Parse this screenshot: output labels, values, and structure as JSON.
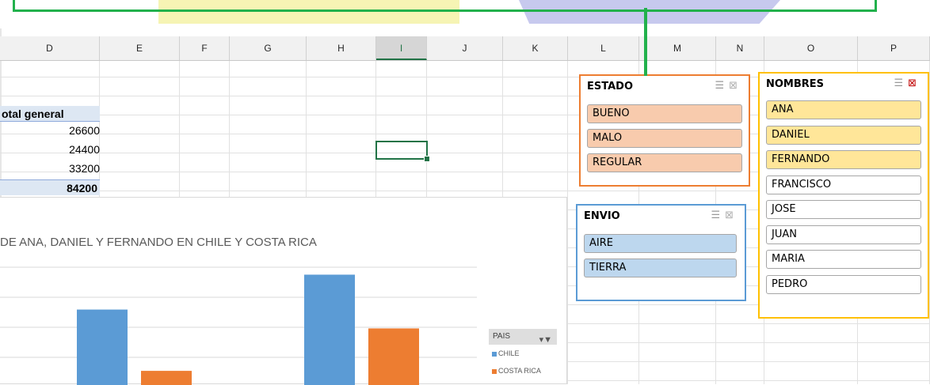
{
  "columns": [
    {
      "label": "D",
      "w": 126
    },
    {
      "label": "E",
      "w": 101
    },
    {
      "label": "F",
      "w": 63
    },
    {
      "label": "G",
      "w": 97
    },
    {
      "label": "H",
      "w": 88
    },
    {
      "label": "I",
      "w": 64,
      "selected": true
    },
    {
      "label": "J",
      "w": 96
    },
    {
      "label": "K",
      "w": 82
    },
    {
      "label": "L",
      "w": 90
    },
    {
      "label": "M",
      "w": 97
    },
    {
      "label": "N",
      "w": 61
    },
    {
      "label": "O",
      "w": 118
    },
    {
      "label": "P",
      "w": 91
    }
  ],
  "pivot": {
    "header": "otal general",
    "values": [
      "26600",
      "24400",
      "33200"
    ],
    "total": "84200"
  },
  "chart_data": {
    "type": "bar",
    "title": "DE ANA, DANIEL Y FERNANDO EN CHILE Y COSTA RICA",
    "legend_title": "PAIS",
    "series": [
      {
        "name": "CHILE",
        "color": "#5b9bd5",
        "values": [
          8000,
          11700
        ]
      },
      {
        "name": "COSTA RICA",
        "color": "#ed7d31",
        "values": [
          1500,
          6000
        ]
      }
    ],
    "ylim": [
      0,
      14000
    ]
  },
  "slicers": {
    "estado": {
      "title": "ESTADO",
      "accent": "#ed7d31",
      "fill": "#f8cbad",
      "items": [
        {
          "label": "BUENO",
          "selected": true
        },
        {
          "label": "MALO",
          "selected": true
        },
        {
          "label": "REGULAR",
          "selected": true
        }
      ]
    },
    "envio": {
      "title": "ENVIO",
      "accent": "#5b9bd5",
      "fill": "#bdd7ee",
      "items": [
        {
          "label": "AIRE",
          "selected": true
        },
        {
          "label": "TIERRA",
          "selected": true
        }
      ]
    },
    "nombres": {
      "title": "NOMBRES",
      "accent": "#ffc000",
      "fill": "#ffe699",
      "items": [
        {
          "label": "ANA",
          "selected": true
        },
        {
          "label": "DANIEL",
          "selected": true
        },
        {
          "label": "FERNANDO",
          "selected": true
        },
        {
          "label": "FRANCISCO",
          "selected": false
        },
        {
          "label": "JOSE",
          "selected": false
        },
        {
          "label": "JUAN",
          "selected": false
        },
        {
          "label": "MARIA",
          "selected": false
        },
        {
          "label": "PEDRO",
          "selected": false
        }
      ]
    }
  },
  "icons": {
    "multiselect": "multi-select-icon",
    "clear_filter": "clear-filter-icon",
    "legend_filter": "filter-icon"
  }
}
